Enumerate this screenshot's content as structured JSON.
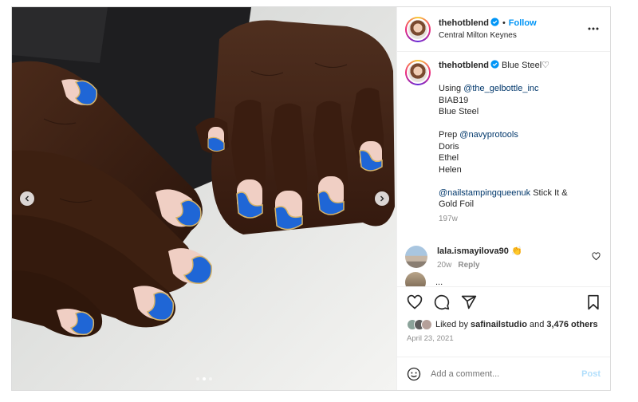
{
  "header": {
    "username": "thehotblend",
    "separator": "•",
    "follow_label": "Follow",
    "location": "Central Milton Keynes"
  },
  "caption": {
    "username": "thehotblend",
    "title": "Blue Steel♡",
    "lines": [
      [
        "",
        "Using ",
        "@the_gelbottle_inc"
      ],
      [
        "BIAB19"
      ],
      [
        "Blue Steel"
      ],
      [
        ""
      ],
      [
        "Prep ",
        "@navyprotools"
      ],
      [
        "Doris"
      ],
      [
        "Ethel"
      ],
      [
        "Helen"
      ],
      [
        ""
      ],
      [
        "@nailstampingqueenuk",
        " Stick It &"
      ],
      [
        "Gold Foil"
      ]
    ],
    "line_text": {
      "l1_text": "Using ",
      "l1_mention": "@the_gelbottle_inc",
      "l2": "BIAB19",
      "l3": "Blue Steel",
      "l5_text": "Prep ",
      "l5_mention": "@navyprotools",
      "l6": "Doris",
      "l7": "Ethel",
      "l8": "Helen",
      "l10_mention": "@nailstampingqueenuk",
      "l10_text": " Stick It &",
      "l11": "Gold Foil"
    },
    "age": "197w"
  },
  "comment": {
    "username": "lala.ismayilova90",
    "emoji": "👏",
    "age": "20w",
    "reply_label": "Reply"
  },
  "partial_comment": {
    "text": "..."
  },
  "likes": {
    "prefix": "Liked by ",
    "user": "safinailstudio",
    "middle": " and ",
    "count": "3,476 others"
  },
  "date": "April 23, 2021",
  "add_comment": {
    "placeholder": "Add a comment...",
    "post_label": "Post"
  },
  "carousel": {
    "slide_count": 3,
    "active_index": 1
  },
  "icons": {
    "verified": "verified-badge-icon",
    "more": "more-options-icon",
    "like": "heart-icon",
    "comment": "comment-icon",
    "share": "share-icon",
    "save": "bookmark-icon",
    "emoji": "emoji-icon",
    "prev": "chevron-left-icon",
    "next": "chevron-right-icon"
  },
  "colors": {
    "link_blue": "#0095f6",
    "mention": "#00376b",
    "muted": "#8e8e8e",
    "post_disabled": "#b2dffc"
  }
}
